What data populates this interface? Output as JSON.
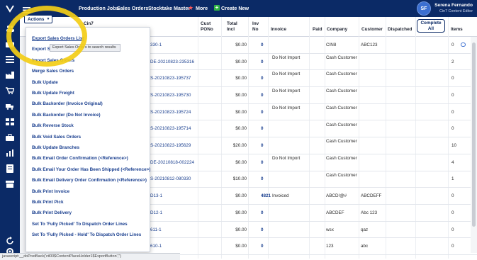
{
  "topnav": {
    "items": [
      {
        "label": "Production Jobs"
      },
      {
        "label": "Sales Orders"
      },
      {
        "label": "Stocktake Master"
      },
      {
        "label": "More"
      },
      {
        "label": "Create New"
      }
    ]
  },
  "user": {
    "initials": "SF",
    "name": "Serena Fernando",
    "role": "Cin7 Content Editor"
  },
  "actions_button": {
    "label": "Actions"
  },
  "tooltip": "Export Sales Orders to search results",
  "menu": {
    "items": [
      "Export Sales Orders List",
      "Export Sales Orders",
      "Import Sales Orders",
      "Merge Sales Orders",
      "Bulk Update",
      "Bulk Update Freight",
      "Bulk Backorder (Invoice Original)",
      "Bulk Backorder (Do Not Invoice)",
      "Bulk Reverse Stock",
      "Bulk Void Sales Orders",
      "Bulk Update Branches",
      "Bulk Email Order Confirmation (<Reference>)",
      "Bulk Email Your Order Has Been Shipped (<Reference>)",
      "Bulk Email Delivery Order Confirmation (<Reference>)",
      "Bulk Print Invoice",
      "Bulk Print Pick",
      "Bulk Print Delivery",
      "Set To 'Fully Picked' To Dispatch Order Lines",
      "Set To 'Fully Picked - Hold' To Dispatch Order Lines"
    ]
  },
  "table": {
    "headers": {
      "cin7": "Cin7",
      "cust_pono": "Cust PONo",
      "total_incl": "Total Incl",
      "inv_no": "Inv No",
      "invoice": "Invoice",
      "paid": "Paid",
      "company": "Company",
      "customer": "Customer",
      "dispatched": "Dispatched",
      "complete_all": "Complete All",
      "items": "Items"
    },
    "rows": [
      {
        "so": "330-1",
        "total": "$0.00",
        "inv": "0",
        "invoice": "",
        "company": "CIN8",
        "customer": "ABC123",
        "items": "0"
      },
      {
        "so": "DE-20210823-235316",
        "total": "$0.00",
        "inv": "0",
        "invoice": "Do Not Import",
        "company": "Cash Customer",
        "customer": "",
        "items": "2"
      },
      {
        "so": "S-20210823-195737",
        "total": "$0.00",
        "inv": "0",
        "invoice": "Do Not Import",
        "company": "Cash Customer",
        "customer": "",
        "items": "0"
      },
      {
        "so": "S-20210823-195730",
        "total": "$0.00",
        "inv": "0",
        "invoice": "Do Not Import",
        "company": "Cash Customer",
        "customer": "",
        "items": "0"
      },
      {
        "so": "S-20210823-195724",
        "total": "$0.00",
        "inv": "0",
        "invoice": "Do Not Import",
        "company": "Cash Customer",
        "customer": "",
        "items": "0"
      },
      {
        "so": "S-20210823-195714",
        "total": "$0.00",
        "inv": "0",
        "invoice": "",
        "company": "Cash Customer",
        "customer": "",
        "items": "0"
      },
      {
        "so": "S-20210823-195629",
        "total": "$20.00",
        "inv": "0",
        "invoice": "",
        "company": "Cash Customer",
        "customer": "",
        "items": "10"
      },
      {
        "so": "DE-20210818-002224",
        "total": "$0.00",
        "inv": "0",
        "invoice": "Do Not Import",
        "company": "Cash Customer",
        "customer": "",
        "items": "4"
      },
      {
        "so": "S-20210812-080330",
        "total": "$10.00",
        "inv": "0",
        "invoice": "",
        "company": "Cash Customer",
        "customer": "",
        "items": "1"
      },
      {
        "so": "D13-1",
        "total": "$0.00",
        "inv": "4821",
        "invoice": "Invoiced",
        "company": "ABCD!@#",
        "customer": "ABCDEFF",
        "items": "0"
      },
      {
        "so": "D12-1",
        "total": "$0.00",
        "inv": "0",
        "invoice": "",
        "company": "ABCDEF",
        "customer": "Abc 123",
        "items": "0"
      },
      {
        "so": "611-1",
        "total": "$0.00",
        "inv": "0",
        "invoice": "",
        "company": "wsx",
        "customer": "qaz",
        "items": "0"
      },
      {
        "so": "610-1",
        "total": "$0.00",
        "inv": "0",
        "invoice": "",
        "company": "123",
        "customer": "abc",
        "items": "0"
      }
    ]
  },
  "status_bar": "javascript:__doPostBack('ctl00$ContentPlaceHolder1$ExportButton','')",
  "colors": {
    "navy": "#0b2a66",
    "link": "#1a3f8f",
    "highlight": "#f3cd16"
  }
}
